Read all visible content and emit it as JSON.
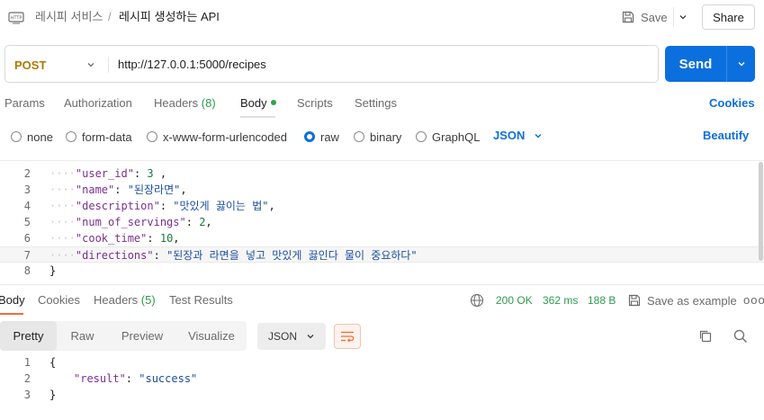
{
  "header": {
    "breadcrumb_parent": "레시피 서비스",
    "breadcrumb_sep": "/",
    "title": "레시피 생성하는 API",
    "save_label": "Save",
    "share_label": "Share"
  },
  "request": {
    "method": "POST",
    "url": "http://127.0.0.1:5000/recipes",
    "send_label": "Send"
  },
  "request_tabs": {
    "params": "Params",
    "authorization": "Authorization",
    "headers": "Headers",
    "headers_count": "(8)",
    "body": "Body",
    "scripts": "Scripts",
    "settings": "Settings",
    "cookies": "Cookies"
  },
  "body_options": {
    "none": "none",
    "form_data": "form-data",
    "urlencoded": "x-www-form-urlencoded",
    "raw": "raw",
    "binary": "binary",
    "graphql": "GraphQL",
    "format": "JSON",
    "beautify": "Beautify",
    "selected": "raw"
  },
  "editor": {
    "lines": [
      {
        "n": "2",
        "key": "\"user_id\"",
        "sep": ": ",
        "value": "3",
        "type": "num",
        "tail": " ,"
      },
      {
        "n": "3",
        "key": "\"name\"",
        "sep": ": ",
        "value": "\"된장라면\"",
        "type": "str",
        "tail": ","
      },
      {
        "n": "4",
        "key": "\"description\"",
        "sep": ": ",
        "value": "\"맛있게 끓이는 법\"",
        "type": "str",
        "tail": ","
      },
      {
        "n": "5",
        "key": "\"num_of_servings\"",
        "sep": ": ",
        "value": "2",
        "type": "num",
        "tail": ","
      },
      {
        "n": "6",
        "key": "\"cook_time\"",
        "sep": ": ",
        "value": "10",
        "type": "num",
        "tail": ","
      },
      {
        "n": "7",
        "key": "\"directions\"",
        "sep": ": ",
        "value": "\"된장과 라면을 넣고 맛있게 끓인다 물이 중요하다\"",
        "type": "str",
        "tail": ""
      }
    ],
    "last_line_num": "8",
    "last_line_code": "}"
  },
  "response": {
    "tabs": {
      "body": "Body",
      "cookies": "Cookies",
      "headers": "Headers",
      "headers_count": "(5)",
      "test_results": "Test Results"
    },
    "status": "200 OK",
    "time": "362 ms",
    "size": "188 B",
    "save_example": "Save as example",
    "more": "ooo",
    "views": {
      "pretty": "Pretty",
      "raw": "Raw",
      "preview": "Preview",
      "visualize": "Visualize"
    },
    "format": "JSON",
    "lines": [
      {
        "n": "1",
        "code": "{"
      },
      {
        "n": "2",
        "key": "\"result\"",
        "sep": ": ",
        "value": "\"success\""
      },
      {
        "n": "3",
        "code": "}"
      }
    ]
  },
  "colors": {
    "accent": "#0b6fde",
    "method": "#b07a00",
    "status_ok": "#2e9b4d",
    "active_tab": "#f26b3a"
  }
}
